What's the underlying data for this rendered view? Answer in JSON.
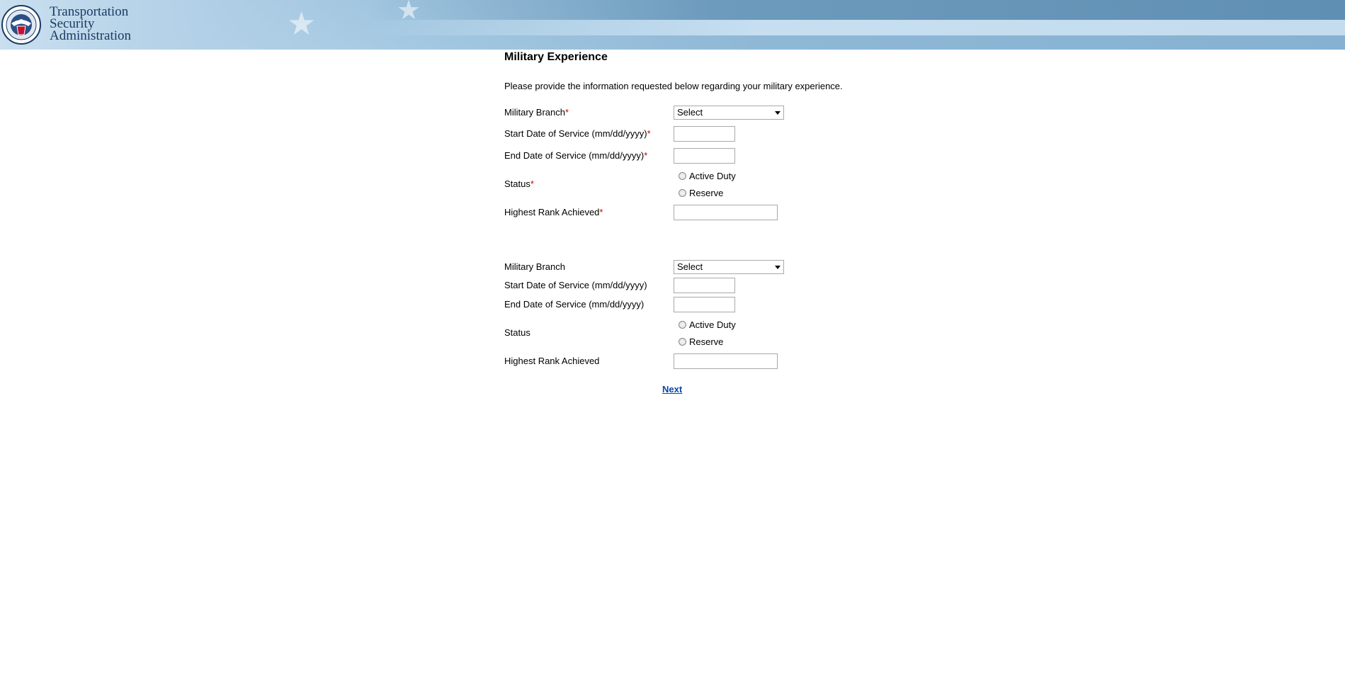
{
  "header": {
    "logo_line1": "Transportation",
    "logo_line2": "Security",
    "logo_line3": "Administration",
    "seal_icon": "dhs-seal-icon"
  },
  "page": {
    "title": "Military Experience",
    "intro": "Please provide the information requested below regarding your military experience."
  },
  "required_marker": "*",
  "entry1": {
    "branch_label": "Military Branch",
    "branch_value": "Select",
    "start_label": "Start Date of Service (mm/dd/yyyy)",
    "start_value": "",
    "end_label": "End Date of Service (mm/dd/yyyy)",
    "end_value": "",
    "status_label": "Status",
    "status_options": [
      "Active Duty",
      "Reserve"
    ],
    "rank_label": "Highest Rank Achieved",
    "rank_value": ""
  },
  "entry2": {
    "branch_label": "Military Branch",
    "branch_value": "Select",
    "start_label": "Start Date of Service (mm/dd/yyyy)",
    "start_value": "",
    "end_label": "End Date of Service (mm/dd/yyyy)",
    "end_value": "",
    "status_label": "Status",
    "status_options": [
      "Active Duty",
      "Reserve"
    ],
    "rank_label": "Highest Rank Achieved",
    "rank_value": ""
  },
  "actions": {
    "next_label": "Next"
  },
  "colors": {
    "required": "#cc0000",
    "link": "#0645ad",
    "header_dark": "#5f8fb3",
    "header_light": "#a7cbe3"
  }
}
